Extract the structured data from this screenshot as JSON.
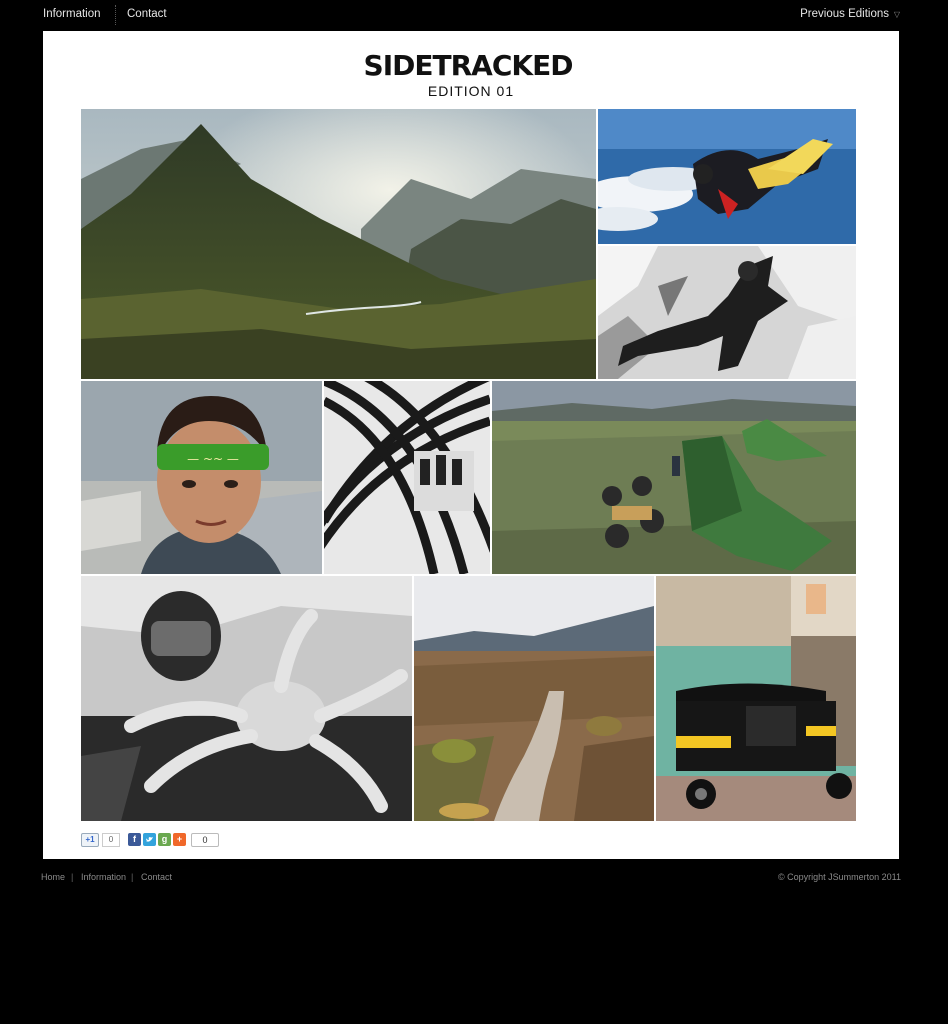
{
  "nav": {
    "information": "Information",
    "contact": "Contact",
    "previous_editions": "Previous Editions"
  },
  "header": {
    "logo_text": "SIDETRACKED",
    "edition": "EDITION 01"
  },
  "photos": [
    {
      "name": "mountain-valley"
    },
    {
      "name": "skydivers"
    },
    {
      "name": "ice-climber"
    },
    {
      "name": "boy-headband"
    },
    {
      "name": "arch-ceiling"
    },
    {
      "name": "tents-camp"
    },
    {
      "name": "diver-crab"
    },
    {
      "name": "volcanic-trail"
    },
    {
      "name": "auto-rickshaw"
    }
  ],
  "share": {
    "gplus_label": "+1",
    "gplus_count": "0",
    "share_count": "0",
    "facebook": "f",
    "google": "g",
    "addthis": "+"
  },
  "footer": {
    "home": "Home",
    "information": "Information",
    "contact": "Contact",
    "separator": "|",
    "copyright": "© Copyright JSummerton 2011"
  },
  "colors": {
    "background": "#000000",
    "panel": "#ffffff"
  }
}
